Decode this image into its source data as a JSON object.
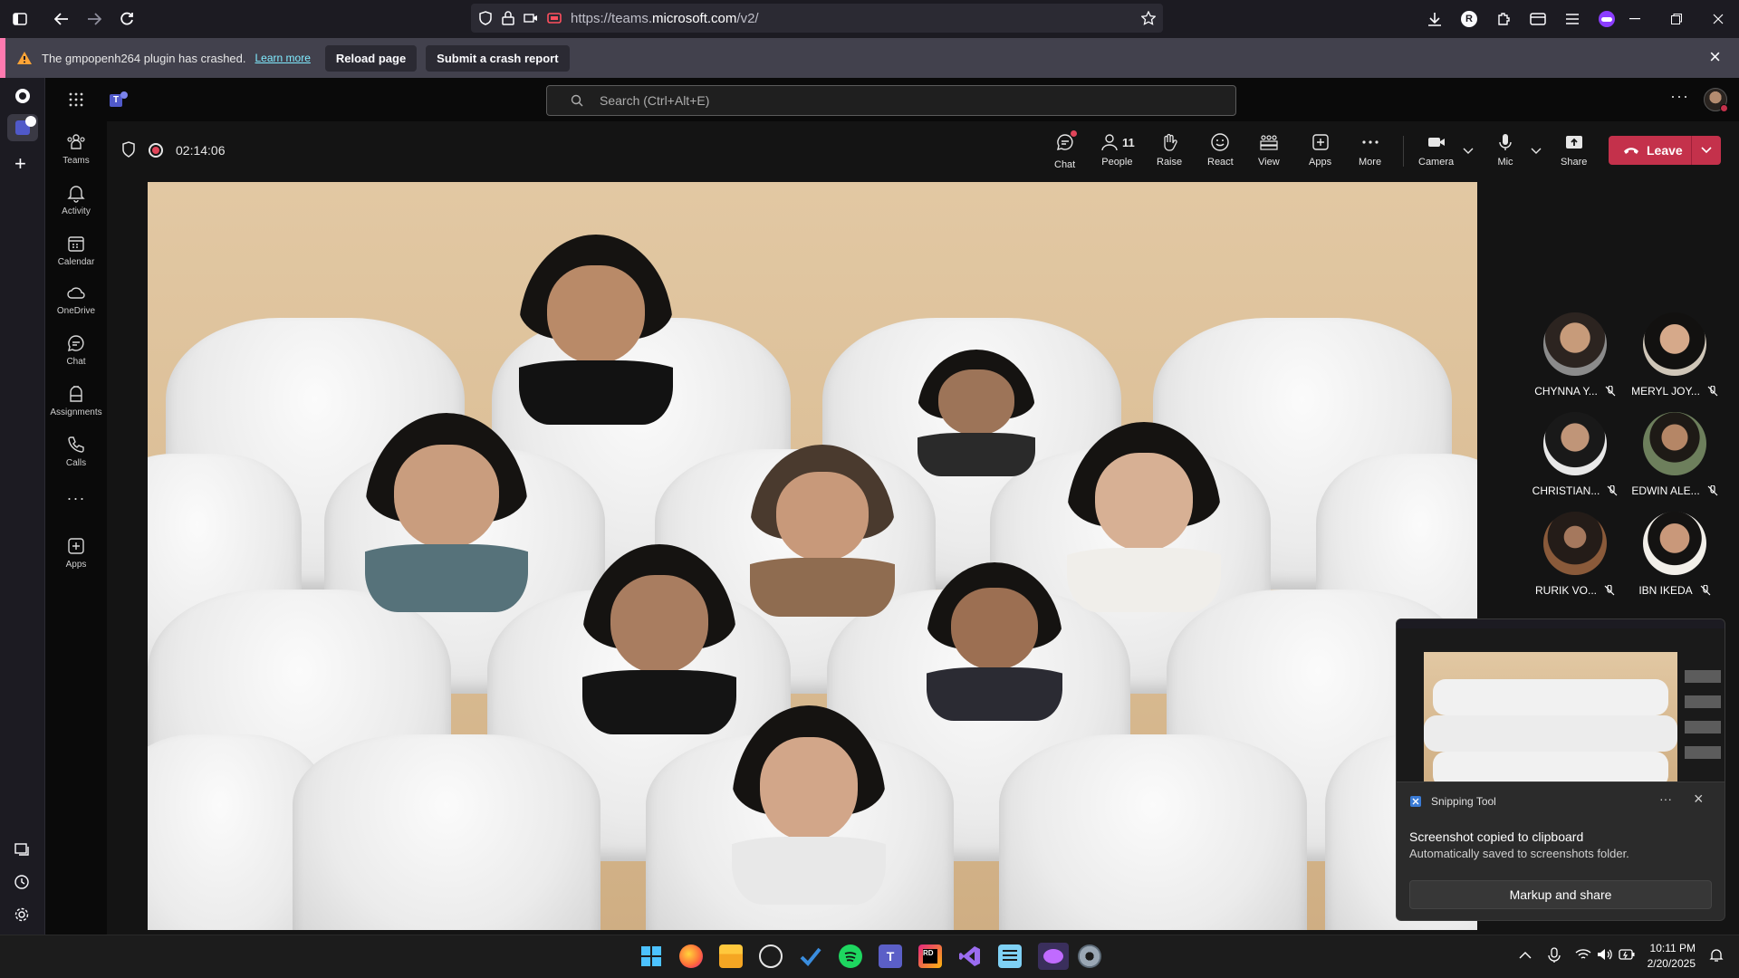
{
  "browser": {
    "url_prefix": "https://teams.",
    "url_domain": "microsoft.com",
    "url_path": "/v2/",
    "profile_initial": "R"
  },
  "crash": {
    "message": "The gmpopenh264 plugin has crashed.",
    "learn_more": "Learn more",
    "reload": "Reload page",
    "submit": "Submit a crash report"
  },
  "teams": {
    "search_placeholder": "Search (Ctrl+Alt+E)",
    "rail": [
      {
        "label": "Teams",
        "icon": "teams-icon"
      },
      {
        "label": "Activity",
        "icon": "bell-icon"
      },
      {
        "label": "Calendar",
        "icon": "calendar-icon"
      },
      {
        "label": "OneDrive",
        "icon": "cloud-icon"
      },
      {
        "label": "Chat",
        "icon": "chat-icon"
      },
      {
        "label": "Assignments",
        "icon": "backpack-icon"
      },
      {
        "label": "Calls",
        "icon": "phone-icon"
      },
      {
        "label": "Apps",
        "icon": "plus-square-icon"
      }
    ],
    "meeting": {
      "timer": "02:14:06",
      "people_count": "11",
      "toolbar": {
        "chat": "Chat",
        "people": "People",
        "raise": "Raise",
        "react": "React",
        "view": "View",
        "apps": "Apps",
        "more": "More",
        "camera": "Camera",
        "mic": "Mic",
        "share": "Share",
        "leave": "Leave"
      },
      "participants": [
        {
          "name": "CHYNNA Y..."
        },
        {
          "name": "MERYL JOY..."
        },
        {
          "name": "CHRISTIAN..."
        },
        {
          "name": "EDWIN ALE..."
        },
        {
          "name": "RURIK VO..."
        },
        {
          "name": "IBN IKEDA"
        }
      ]
    }
  },
  "snipping": {
    "app": "Snipping Tool",
    "title": "Screenshot copied to clipboard",
    "subtitle": "Automatically saved to screenshots folder.",
    "action": "Markup and share"
  },
  "clock": {
    "time": "10:11 PM",
    "date": "2/20/2025"
  },
  "colors": {
    "leave_red": "#c4314b",
    "crash_accent": "#ff7ab0",
    "link": "#80ebff"
  }
}
